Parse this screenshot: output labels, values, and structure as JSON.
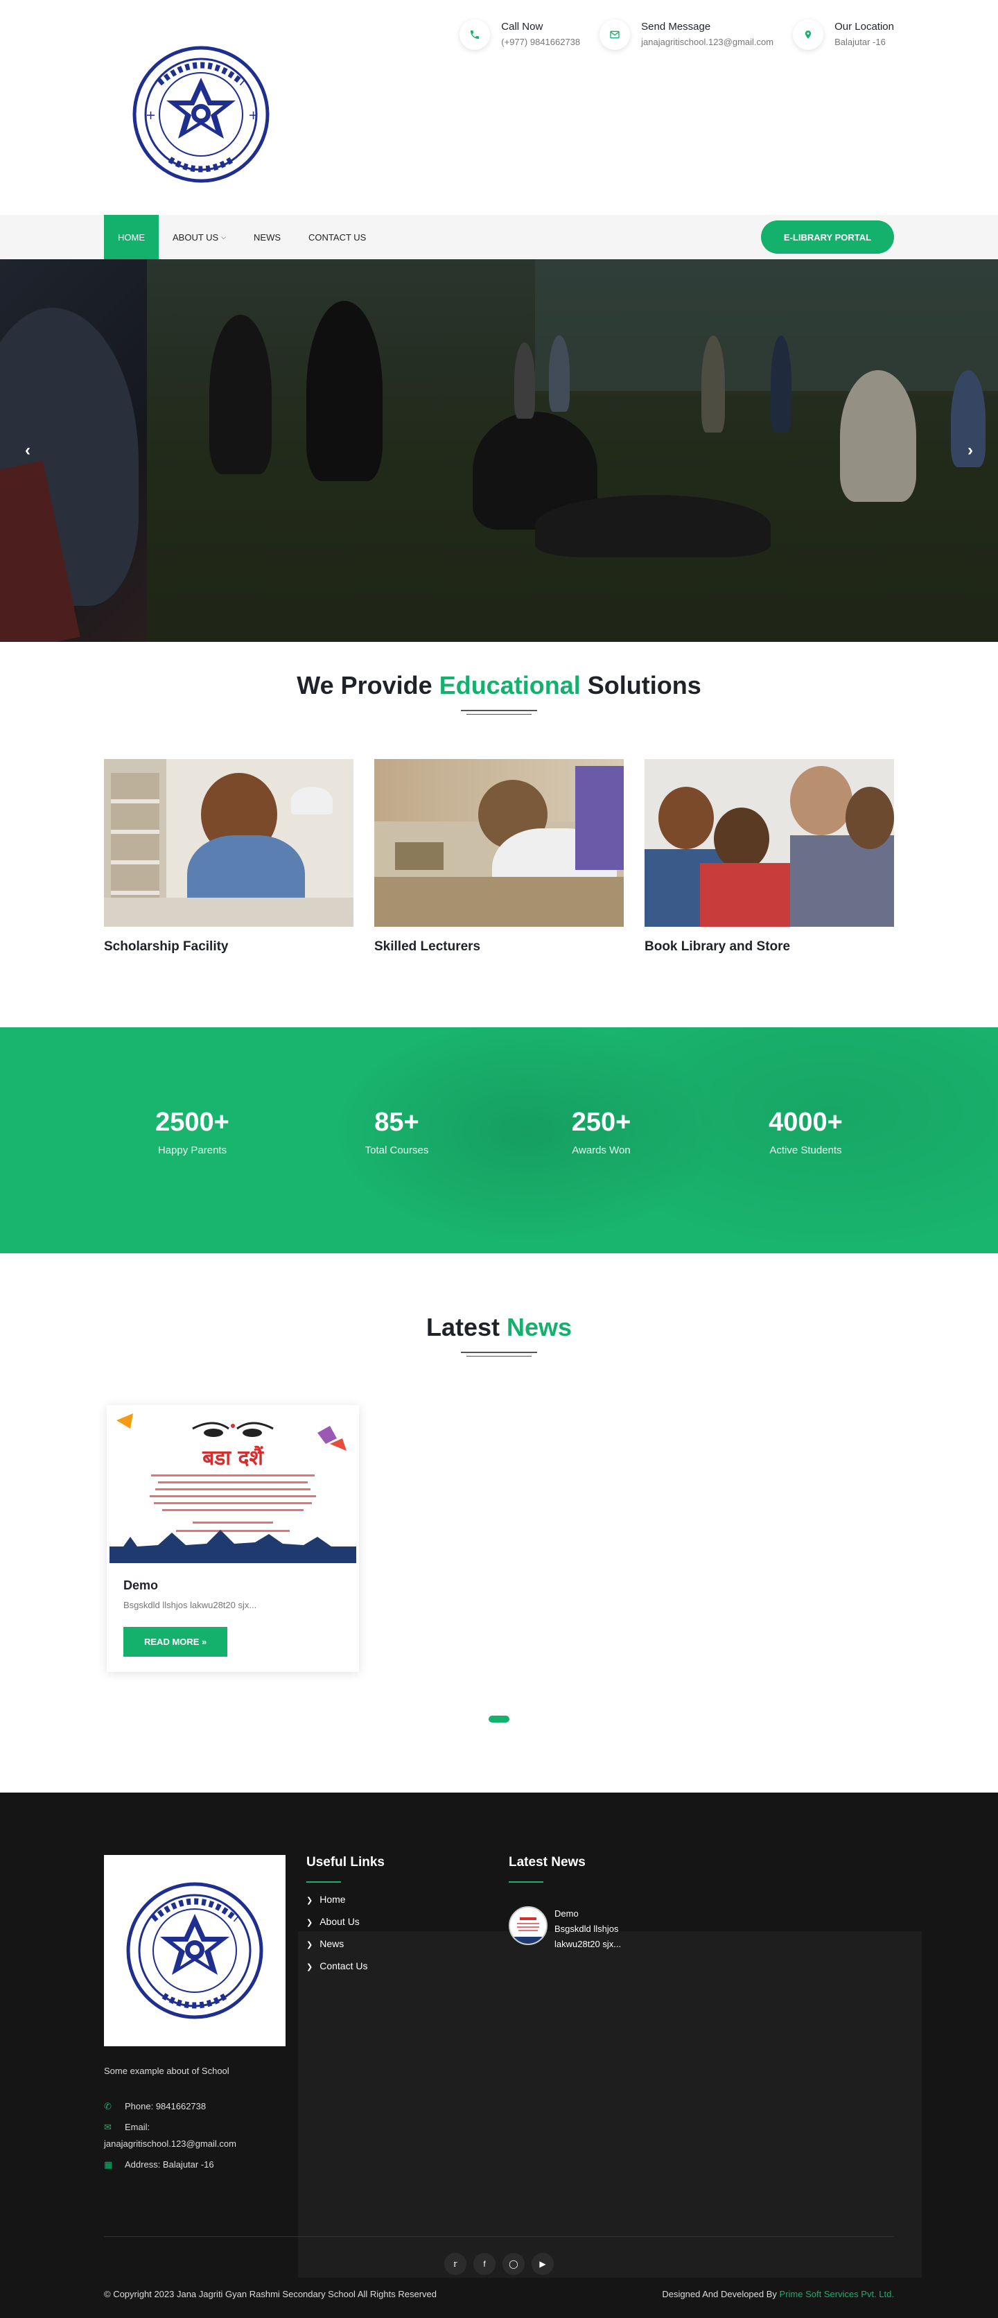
{
  "header": {
    "contacts": [
      {
        "icon": "phone-icon",
        "title": "Call Now",
        "value": "(+977) 9841662738"
      },
      {
        "icon": "envelope-icon",
        "title": "Send Message",
        "value": "janajagritischool.123@gmail.com"
      },
      {
        "icon": "map-marker-icon",
        "title": "Our Location",
        "value": "Balajutar -16"
      }
    ]
  },
  "nav": {
    "items": [
      {
        "label": "HOME"
      },
      {
        "label": "ABOUT US"
      },
      {
        "label": "NEWS"
      },
      {
        "label": "CONTACT US"
      }
    ],
    "portal_button": "E-LIBRARY PORTAL"
  },
  "hero": {
    "prev_arrow": "‹",
    "next_arrow": "›"
  },
  "solutions": {
    "title_before": "We Provide",
    "title_highlight": "Educational",
    "title_after": "Solutions",
    "cards": [
      {
        "title": "Scholarship Facility"
      },
      {
        "title": "Skilled Lecturers"
      },
      {
        "title": "Book Library and Store"
      }
    ]
  },
  "counters": [
    {
      "value": "2500+",
      "label": "Happy Parents"
    },
    {
      "value": "85+",
      "label": "Total Courses"
    },
    {
      "value": "250+",
      "label": "Awards Won"
    },
    {
      "value": "4000+",
      "label": "Active Students"
    }
  ],
  "news": {
    "title_before": "Latest",
    "title_highlight": "News",
    "card": {
      "poster_heading": "बडा दशैं",
      "title": "Demo",
      "excerpt": "Bsgskdld llshjos lakwu28t20 sjx...",
      "button": "READ MORE »"
    }
  },
  "footer": {
    "about": "Some example about of School",
    "phone": "Phone: 9841662738",
    "email_label": "Email:",
    "email": "janajagritischool.123@gmail.com",
    "address": "Address: Balajutar -16",
    "useful_links_title": "Useful Links",
    "useful_links": [
      "Home",
      "About Us",
      "News",
      "Contact Us"
    ],
    "latest_news_title": "Latest News",
    "latest_news": {
      "title": "Demo",
      "line1": "Bsgskdld llshjos",
      "line2": "lakwu28t20 sjx..."
    },
    "socials": [
      "twitter-icon",
      "facebook-icon",
      "instagram-icon",
      "youtube-icon"
    ],
    "copyright": "© Copyright 2023 Jana Jagriti Gyan Rashmi Secondary School All Rights Reserved",
    "designed_by": "Designed And Developed By",
    "designer": "Prime Soft Services Pvt. Ltd."
  },
  "colors": {
    "accent": "#13b16c",
    "footer_bg": "#151515",
    "seal_blue": "#1e2f8f"
  }
}
